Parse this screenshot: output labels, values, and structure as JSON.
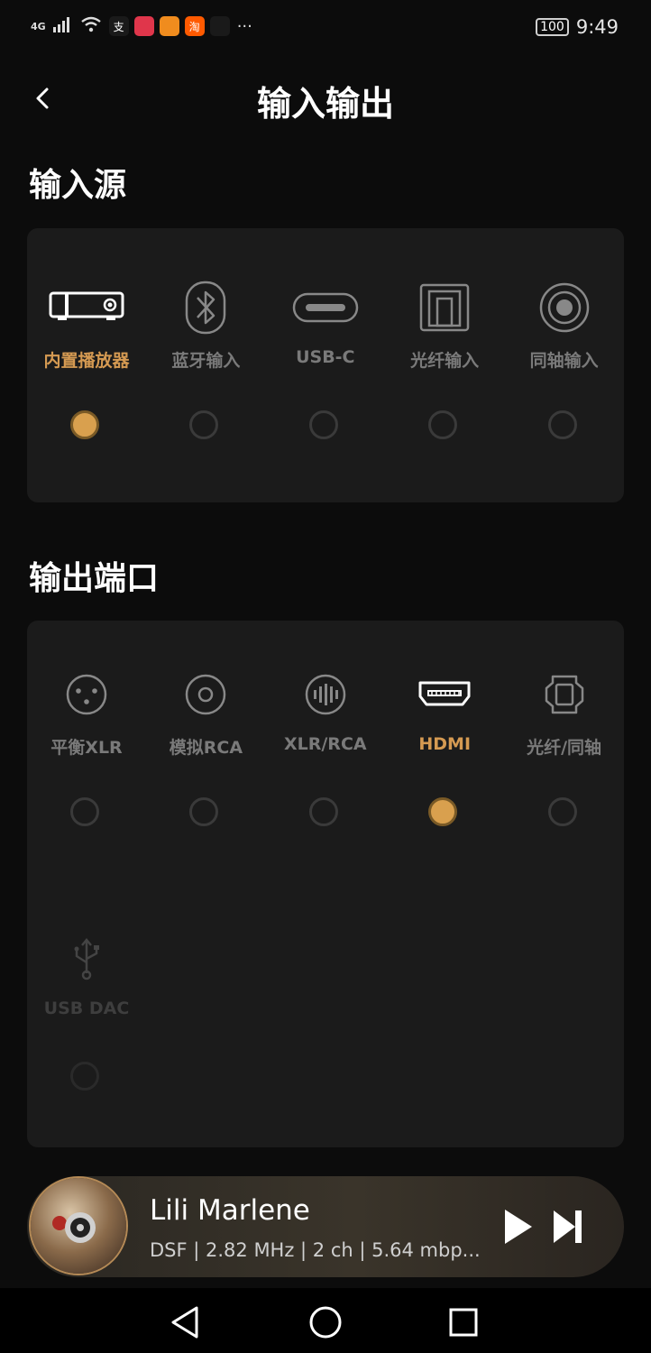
{
  "status_bar": {
    "network": "4G",
    "time": "9:49",
    "battery": "100",
    "more": "···",
    "app_icons": [
      {
        "name": "alipay-icon",
        "glyph": "支",
        "color": "#1a1a1a"
      },
      {
        "name": "app-icon-1",
        "glyph": "",
        "color": "#e0364b"
      },
      {
        "name": "app-icon-2",
        "glyph": "",
        "color": "#f08c1e"
      },
      {
        "name": "taobao-icon",
        "glyph": "淘",
        "color": "#ff5a00"
      },
      {
        "name": "hand-icon",
        "glyph": "",
        "color": "#1a1a1a"
      }
    ]
  },
  "header": {
    "title": "输入输出"
  },
  "input_section": {
    "title": "输入源",
    "options": [
      {
        "label": "内置播放器",
        "icon": "player-icon",
        "selected": true
      },
      {
        "label": "蓝牙输入",
        "icon": "bluetooth-icon",
        "selected": false
      },
      {
        "label": "USB-C",
        "icon": "usb-c-icon",
        "selected": false
      },
      {
        "label": "光纤输入",
        "icon": "optical-icon",
        "selected": false
      },
      {
        "label": "同轴输入",
        "icon": "coaxial-icon",
        "selected": false
      }
    ]
  },
  "output_section": {
    "title": "输出端口",
    "options": [
      {
        "label": "平衡XLR",
        "icon": "xlr-icon",
        "selected": false
      },
      {
        "label": "模拟RCA",
        "icon": "rca-icon",
        "selected": false
      },
      {
        "label": "XLR/RCA",
        "icon": "xlr-rca-icon",
        "selected": false
      },
      {
        "label": "HDMI",
        "icon": "hdmi-icon",
        "selected": true
      },
      {
        "label": "光纤/同轴",
        "icon": "optical-coaxial-icon",
        "selected": false
      },
      {
        "label": "USB DAC",
        "icon": "usb-icon",
        "selected": false,
        "disabled": true
      }
    ]
  },
  "player": {
    "song": "Lili Marlene",
    "meta": "DSF | 2.82 MHz | 2 ch | 5.64 mbp..."
  },
  "colors": {
    "accent": "#d9a04e",
    "card": "#1b1b1b",
    "background": "#0c0c0c"
  }
}
